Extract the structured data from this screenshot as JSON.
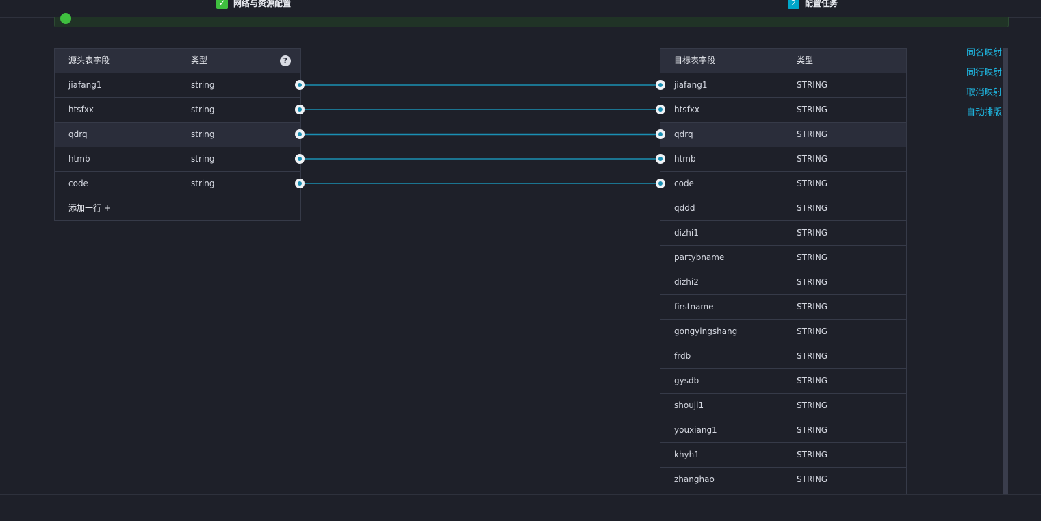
{
  "steps": {
    "step1_label": "网络与资源配置",
    "step2_number": "2",
    "step2_label": "配置任务"
  },
  "source_table": {
    "header_field": "源头表字段",
    "header_type": "类型",
    "help_icon": "?",
    "rows": [
      {
        "field": "jiafang1",
        "type": "string"
      },
      {
        "field": "htsfxx",
        "type": "string"
      },
      {
        "field": "qdrq",
        "type": "string"
      },
      {
        "field": "htmb",
        "type": "string"
      },
      {
        "field": "code",
        "type": "string"
      }
    ],
    "add_row_label": "添加一行 +"
  },
  "target_table": {
    "header_field": "目标表字段",
    "header_type": "类型",
    "rows": [
      {
        "field": "jiafang1",
        "type": "STRING"
      },
      {
        "field": "htsfxx",
        "type": "STRING"
      },
      {
        "field": "qdrq",
        "type": "STRING"
      },
      {
        "field": "htmb",
        "type": "STRING"
      },
      {
        "field": "code",
        "type": "STRING"
      },
      {
        "field": "qddd",
        "type": "STRING"
      },
      {
        "field": "dizhi1",
        "type": "STRING"
      },
      {
        "field": "partybname",
        "type": "STRING"
      },
      {
        "field": "dizhi2",
        "type": "STRING"
      },
      {
        "field": "firstname",
        "type": "STRING"
      },
      {
        "field": "gongyingshang",
        "type": "STRING"
      },
      {
        "field": "frdb",
        "type": "STRING"
      },
      {
        "field": "gysdb",
        "type": "STRING"
      },
      {
        "field": "shouji1",
        "type": "STRING"
      },
      {
        "field": "youxiang1",
        "type": "STRING"
      },
      {
        "field": "khyh1",
        "type": "STRING"
      },
      {
        "field": "zhanghao",
        "type": "STRING"
      }
    ]
  },
  "mappings": [
    {
      "source": "jiafang1",
      "target": "jiafang1"
    },
    {
      "source": "htsfxx",
      "target": "htsfxx"
    },
    {
      "source": "qdrq",
      "target": "qdrq"
    },
    {
      "source": "htmb",
      "target": "htmb"
    },
    {
      "source": "code",
      "target": "code"
    }
  ],
  "highlighted_row": "qdrq",
  "actions": {
    "same_name": "同名映射",
    "same_row": "同行映射",
    "cancel": "取消映射",
    "auto_layout": "自动排版"
  },
  "colors": {
    "accent": "#1fb6e0",
    "link_line": "#1a8fb3",
    "success": "#3fbf3f"
  }
}
